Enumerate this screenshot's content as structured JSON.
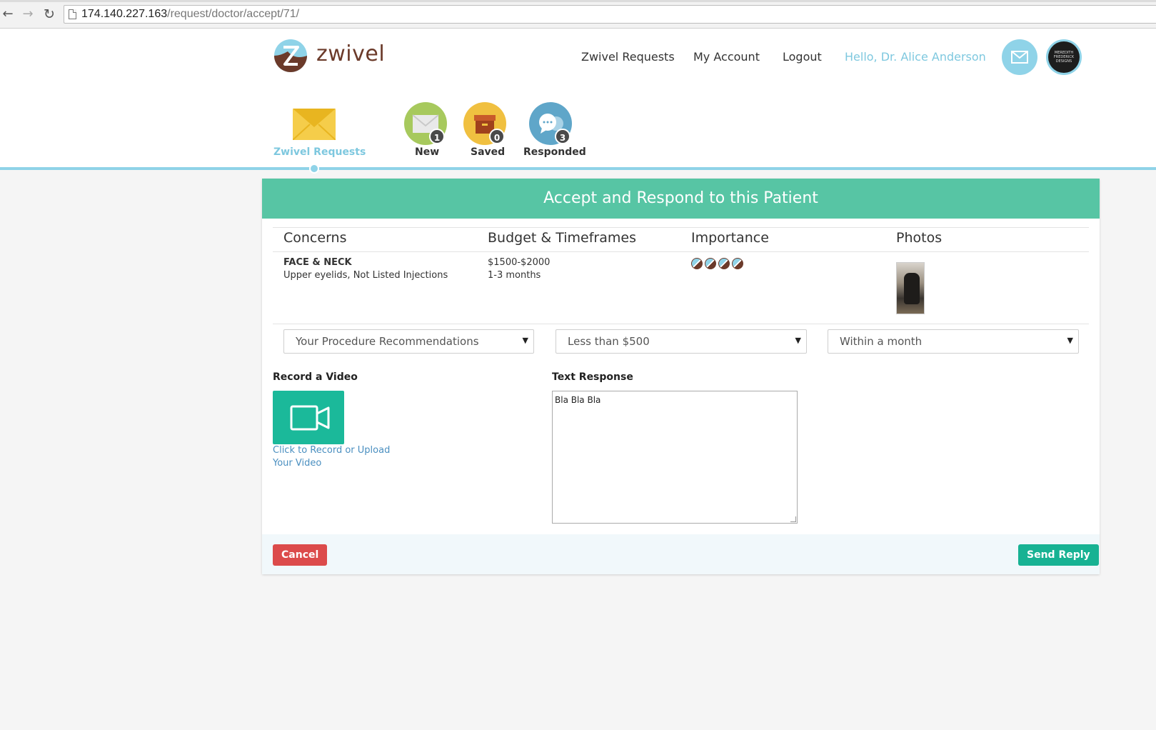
{
  "browser": {
    "url_host": "174.140.227.163",
    "url_path": "/request/doctor/accept/71/"
  },
  "header": {
    "logo_text": "zwivel",
    "nav": {
      "requests": "Zwivel Requests",
      "account": "My Account",
      "logout": "Logout",
      "hello": "Hello, Dr. Alice Anderson"
    },
    "avatar_text": "MEREDITH FREDERICK DESIGNS"
  },
  "categories": {
    "main_label": "Zwivel Requests",
    "new": {
      "label": "New",
      "count": "1"
    },
    "saved": {
      "label": "Saved",
      "count": "0"
    },
    "responded": {
      "label": "Responded",
      "count": "3"
    }
  },
  "card": {
    "title": "Accept and Respond to this Patient",
    "columns": {
      "concerns": "Concerns",
      "budget": "Budget & Timeframes",
      "importance": "Importance",
      "photos": "Photos"
    },
    "row": {
      "concern_area": "FACE & NECK",
      "concern_detail": "Upper eyelids, Not Listed Injections",
      "budget": "$1500-$2000",
      "timeframe": "1-3 months",
      "importance_level": 4
    },
    "selects": {
      "procedure": "Your Procedure Recommendations",
      "budget": "Less than $500",
      "timeframe": "Within a month"
    },
    "video": {
      "label": "Record a Video",
      "link_line1": "Click to Record or Upload",
      "link_line2": "Your Video"
    },
    "text_response": {
      "label": "Text Response",
      "value": "Bla Bla Bla"
    },
    "buttons": {
      "cancel": "Cancel",
      "send": "Send Reply"
    }
  },
  "colors": {
    "header_green": "#57c5a4",
    "accent_blue": "#8fd3e8",
    "brand_brown": "#6b3a2a",
    "cancel_red": "#dc4b4b",
    "send_green": "#17b293"
  }
}
